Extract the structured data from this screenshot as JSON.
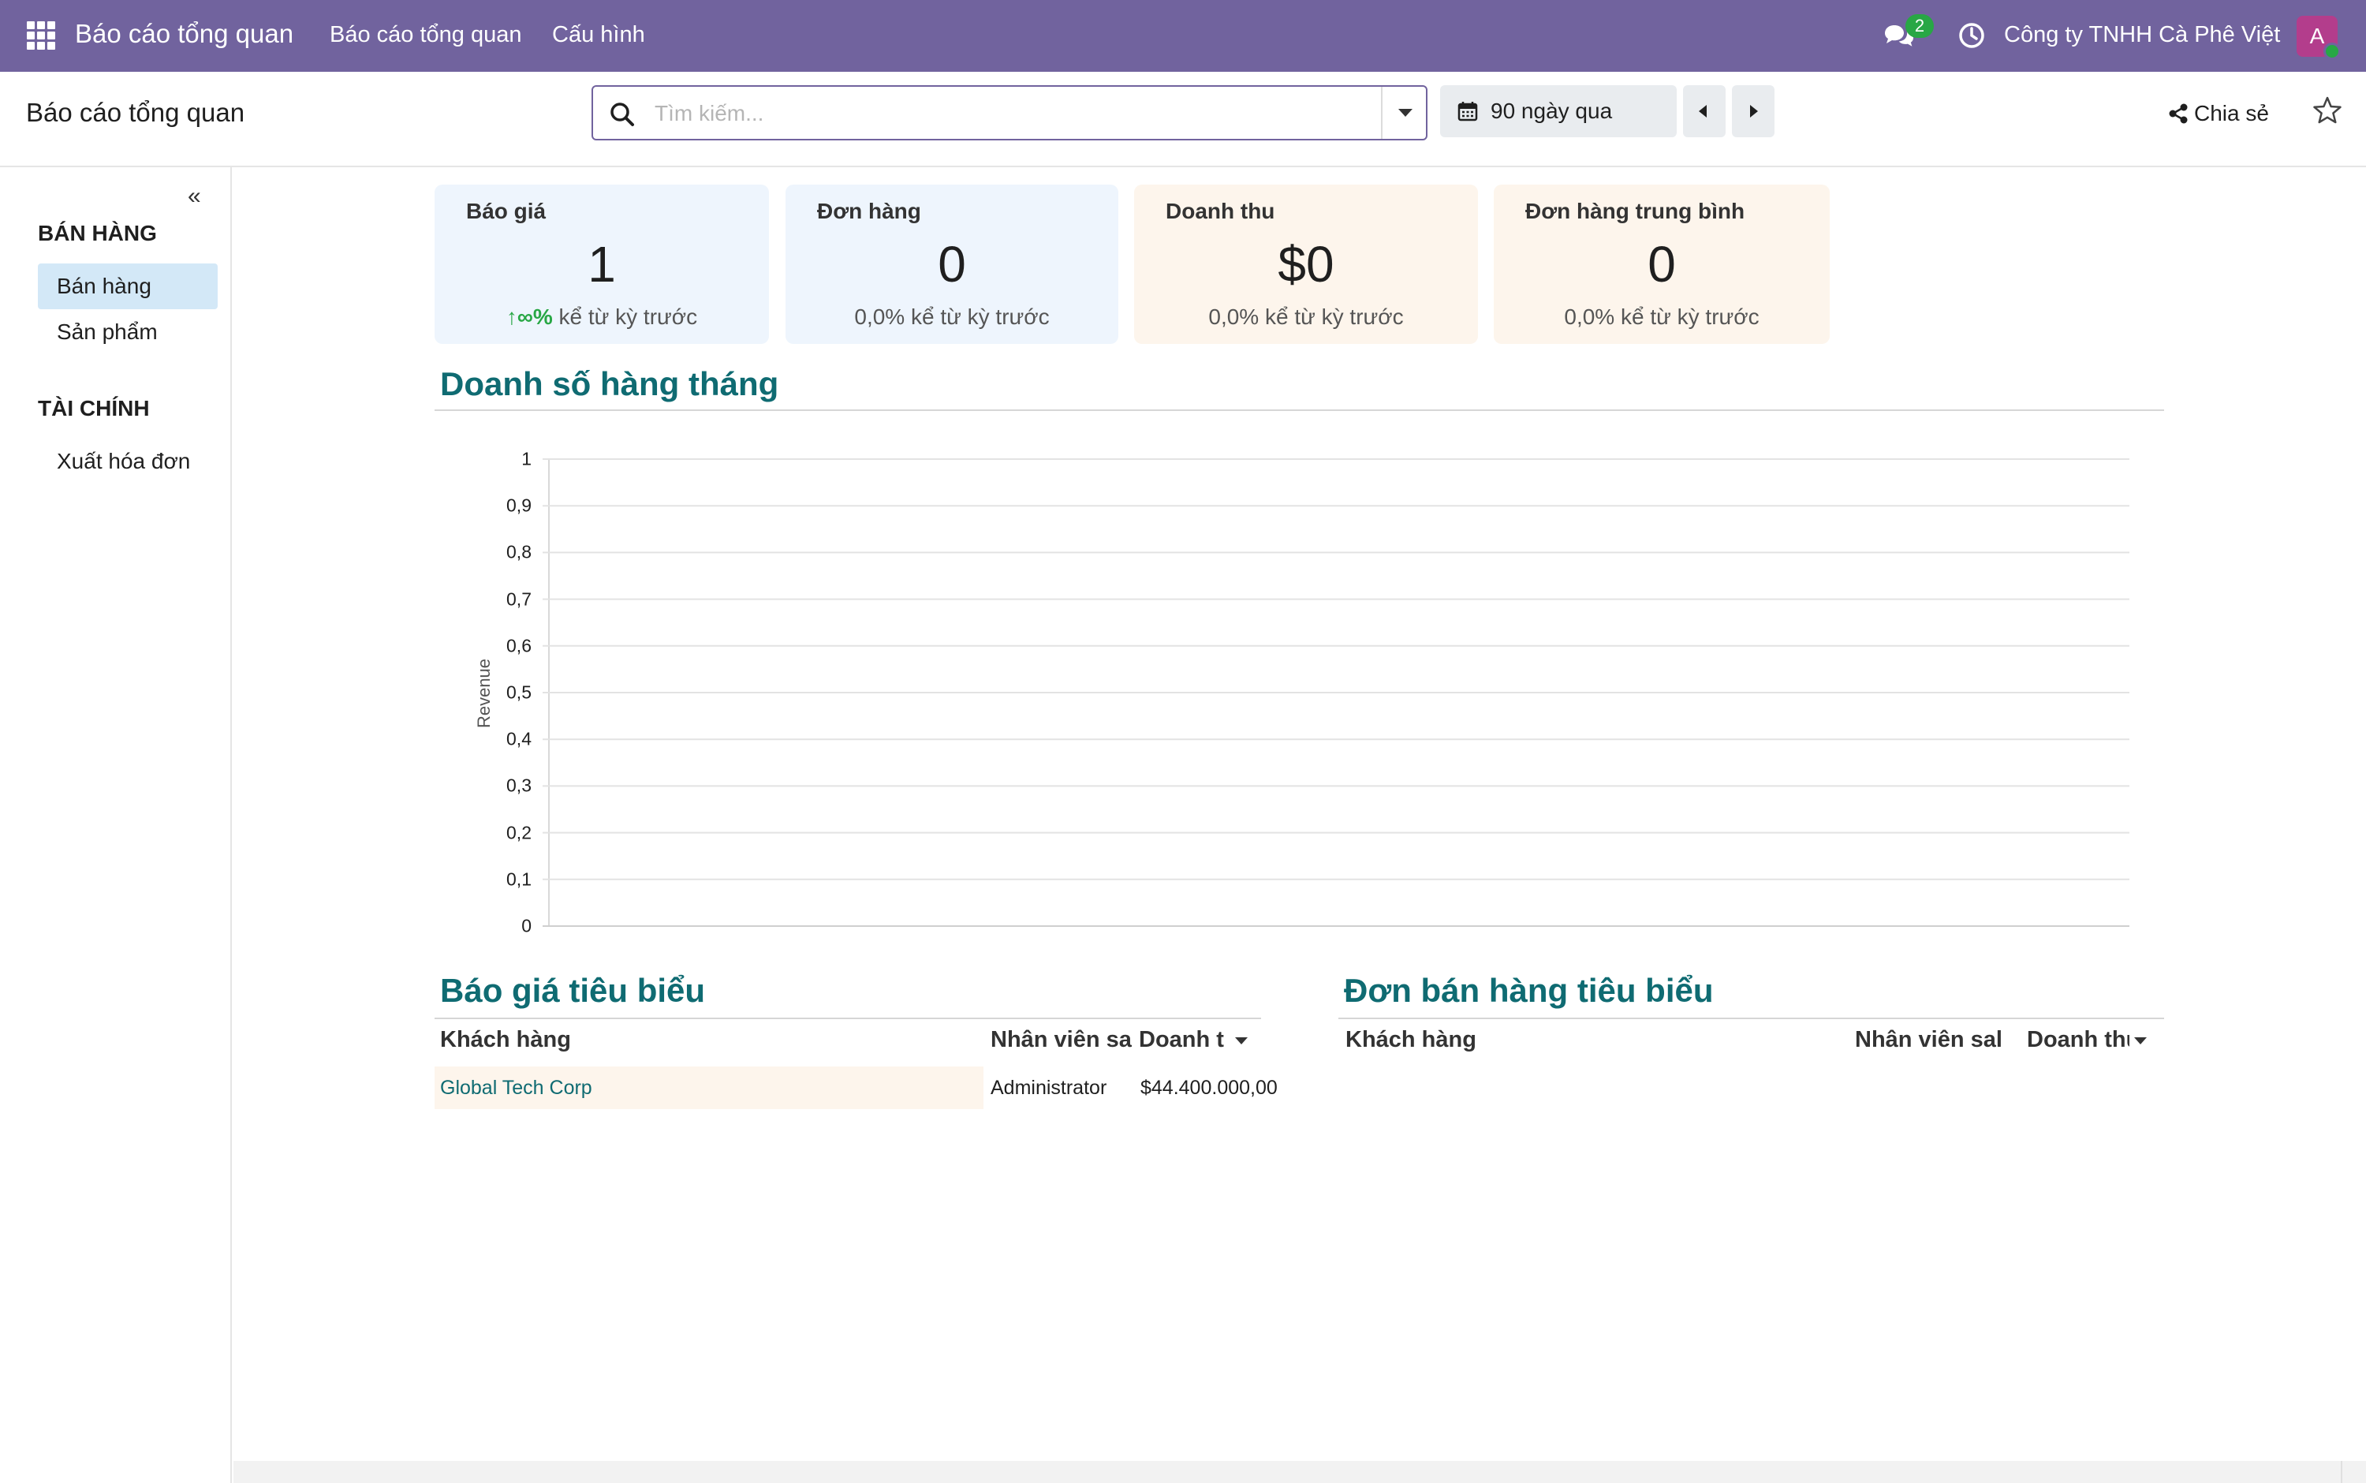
{
  "navbar": {
    "brand": "Báo cáo tổng quan",
    "menu": [
      "Báo cáo tổng quan",
      "Cấu hình"
    ],
    "chat_badge": "2",
    "company": "Công ty TNHH Cà Phê Việt",
    "avatar_initial": "A",
    "accent_color": "#71639e"
  },
  "control": {
    "page_title": "Báo cáo tổng quan",
    "search_placeholder": "Tìm kiếm...",
    "date_filter": "90 ngày qua",
    "share_label": "Chia sẻ"
  },
  "sidebar": {
    "sections": [
      {
        "title": "BÁN HÀNG",
        "items": [
          {
            "label": "Bán hàng",
            "active": true
          },
          {
            "label": "Sản phẩm",
            "active": false
          }
        ]
      },
      {
        "title": "TÀI CHÍNH",
        "items": [
          {
            "label": "Xuất hóa đơn",
            "active": false
          }
        ]
      }
    ]
  },
  "kpis": [
    {
      "title": "Báo giá",
      "value": "1",
      "delta_value": "∞%",
      "delta_text": " kể từ kỳ trước",
      "trend": "up",
      "color": "blue"
    },
    {
      "title": "Đơn hàng",
      "value": "0",
      "delta_value": "0,0%",
      "delta_text": " kể từ kỳ trước",
      "trend": "flat",
      "color": "blue"
    },
    {
      "title": "Doanh thu",
      "value": "$0",
      "delta_value": "0,0%",
      "delta_text": " kể từ kỳ trước",
      "trend": "flat",
      "color": "orange"
    },
    {
      "title": "Đơn hàng trung bình",
      "value": "0",
      "delta_value": "0,0%",
      "delta_text": " kể từ kỳ trước",
      "trend": "flat",
      "color": "orange"
    }
  ],
  "sections": {
    "monthly_sales": "Doanh số hàng tháng",
    "top_quotes": "Báo giá tiêu biểu",
    "top_orders": "Đơn bán hàng tiêu biểu"
  },
  "chart_data": {
    "type": "bar",
    "title": "Doanh số hàng tháng",
    "xlabel": "",
    "ylabel": "Revenue",
    "ylim": [
      0,
      1
    ],
    "yticks": [
      "0",
      "0,1",
      "0,2",
      "0,3",
      "0,4",
      "0,5",
      "0,6",
      "0,7",
      "0,8",
      "0,9",
      "1"
    ],
    "categories": [],
    "values": [],
    "grid": true
  },
  "quotes_table": {
    "columns": [
      "Khách hàng",
      "Nhân viên sa",
      "Doanh t"
    ],
    "rows": [
      {
        "customer": "Global Tech Corp",
        "salesperson": "Administrator",
        "revenue": "$44.400.000,00"
      }
    ]
  },
  "orders_table": {
    "columns": [
      "Khách hàng",
      "Nhân viên sal",
      "Doanh thu"
    ],
    "rows": []
  }
}
